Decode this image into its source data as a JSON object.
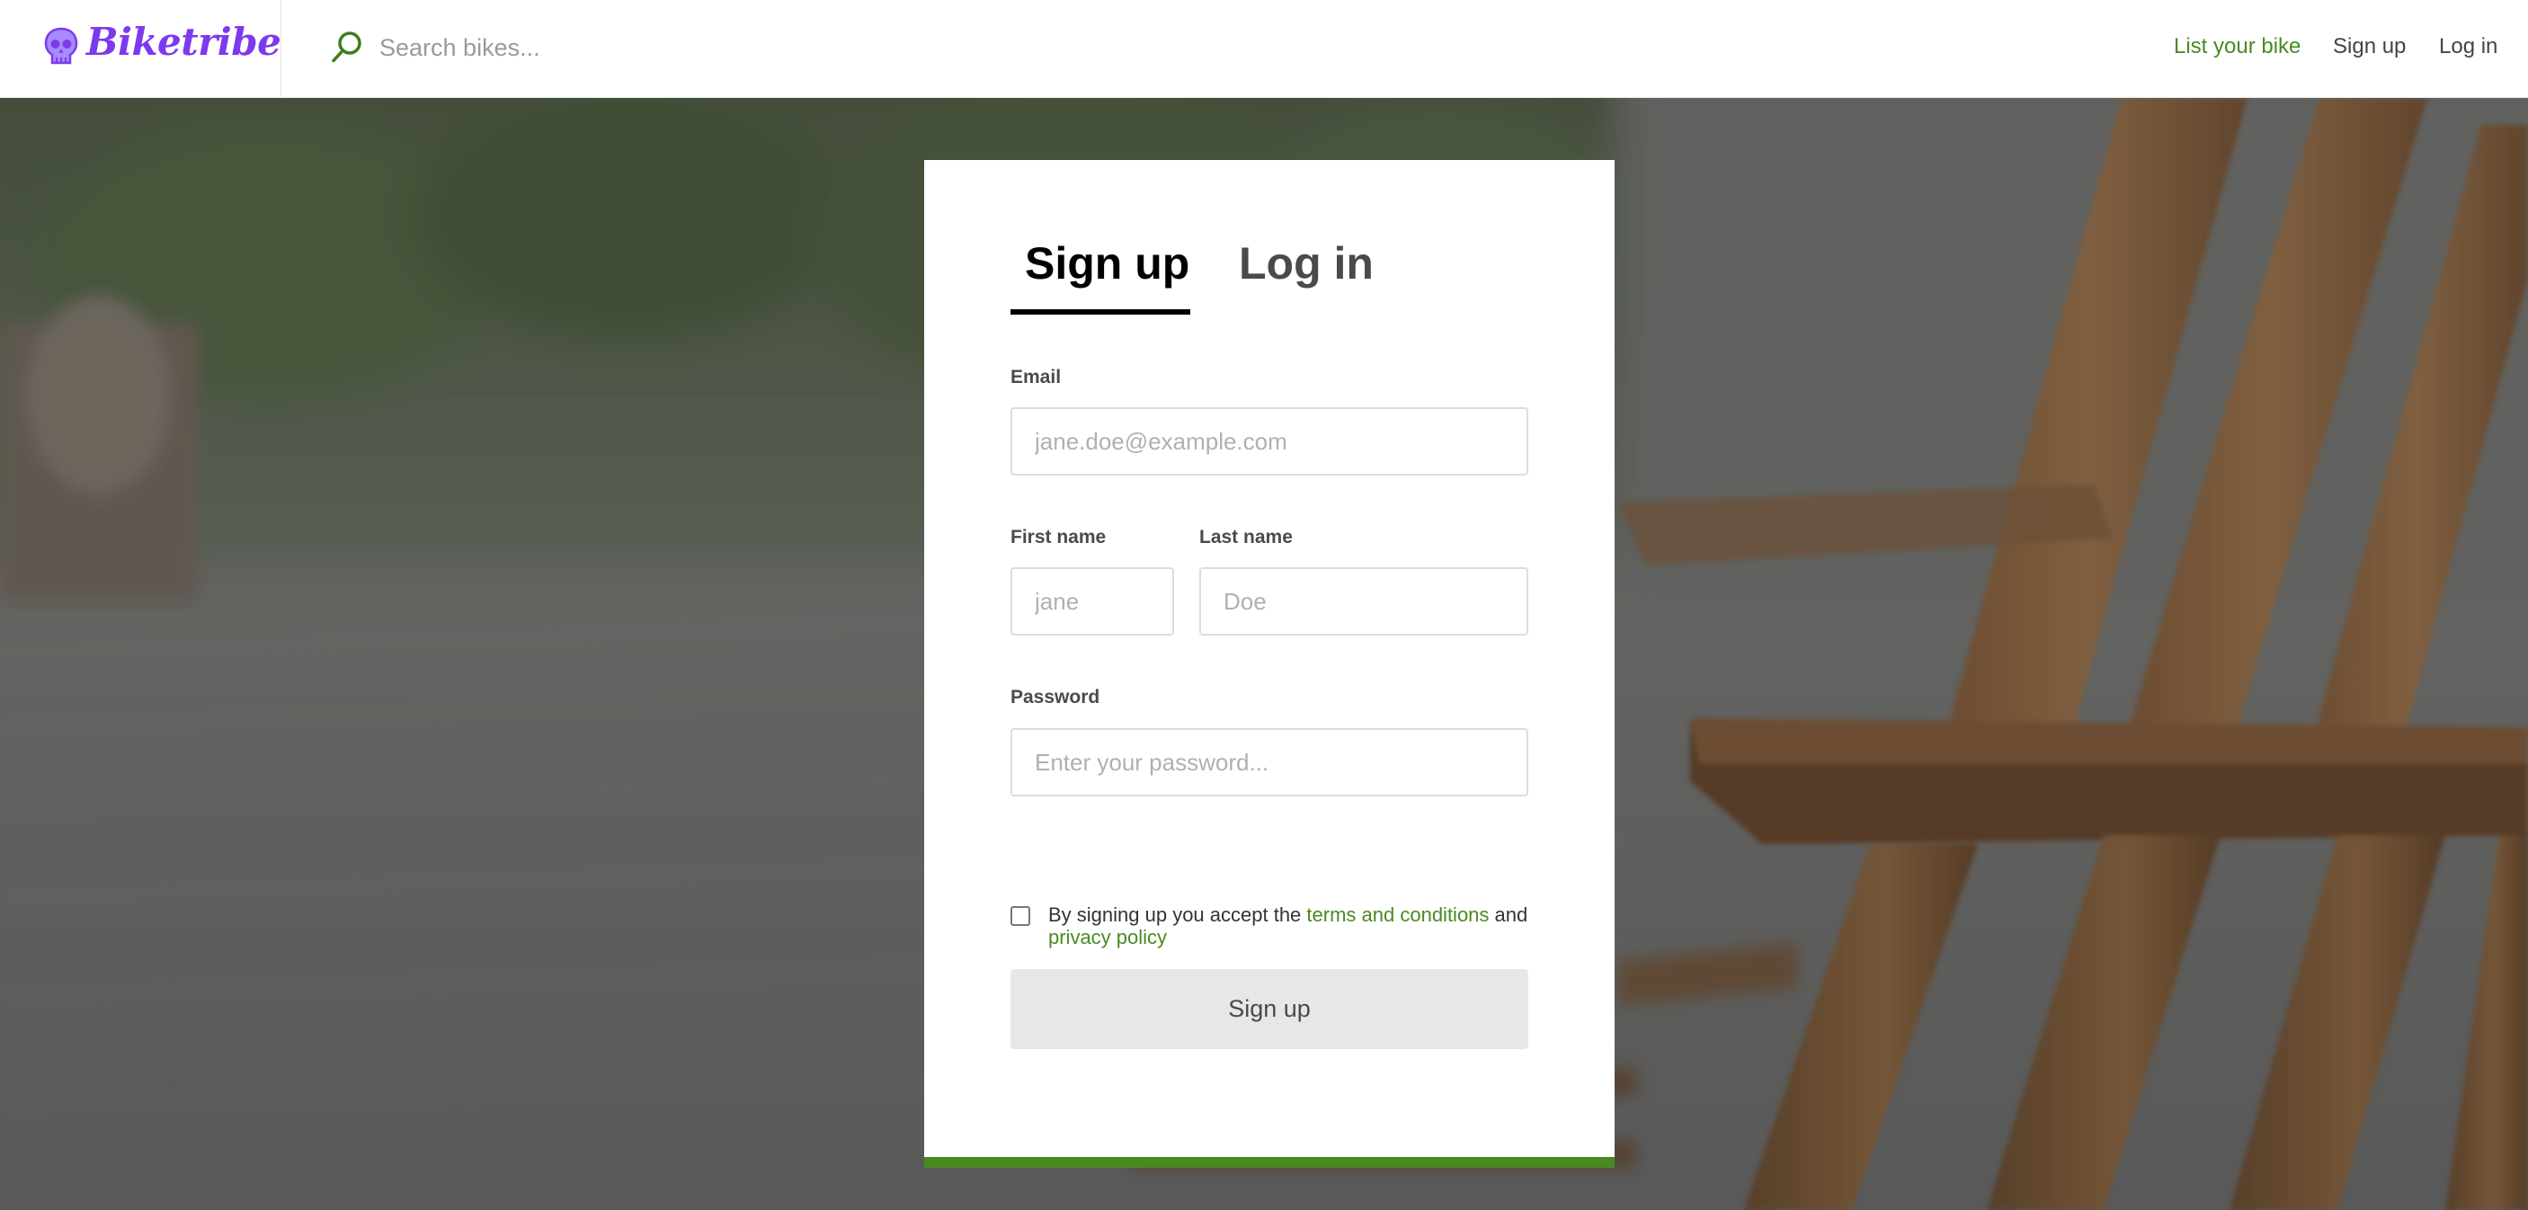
{
  "app": {
    "name": "Biketribe",
    "brand_color": "#7c3aed",
    "accent_color": "#4a8a22"
  },
  "header": {
    "search_placeholder": "Search bikes...",
    "nav": {
      "list_bike": "List your bike",
      "sign_up": "Sign up",
      "log_in": "Log in"
    }
  },
  "auth": {
    "tabs": {
      "sign_up": "Sign up",
      "log_in": "Log in"
    },
    "active_tab": "sign_up",
    "email": {
      "label": "Email",
      "placeholder": "jane.doe@example.com",
      "value": ""
    },
    "first_name": {
      "label": "First name",
      "placeholder": "jane",
      "value": ""
    },
    "last_name": {
      "label": "Last name",
      "placeholder": "Doe",
      "value": ""
    },
    "password": {
      "label": "Password",
      "placeholder": "Enter your password...",
      "value": ""
    },
    "terms": {
      "checked": false,
      "prefix": "By signing up you accept the ",
      "terms_link": "terms and conditions",
      "middle": " and ",
      "privacy_link": "privacy policy"
    },
    "submit_label": "Sign up"
  }
}
